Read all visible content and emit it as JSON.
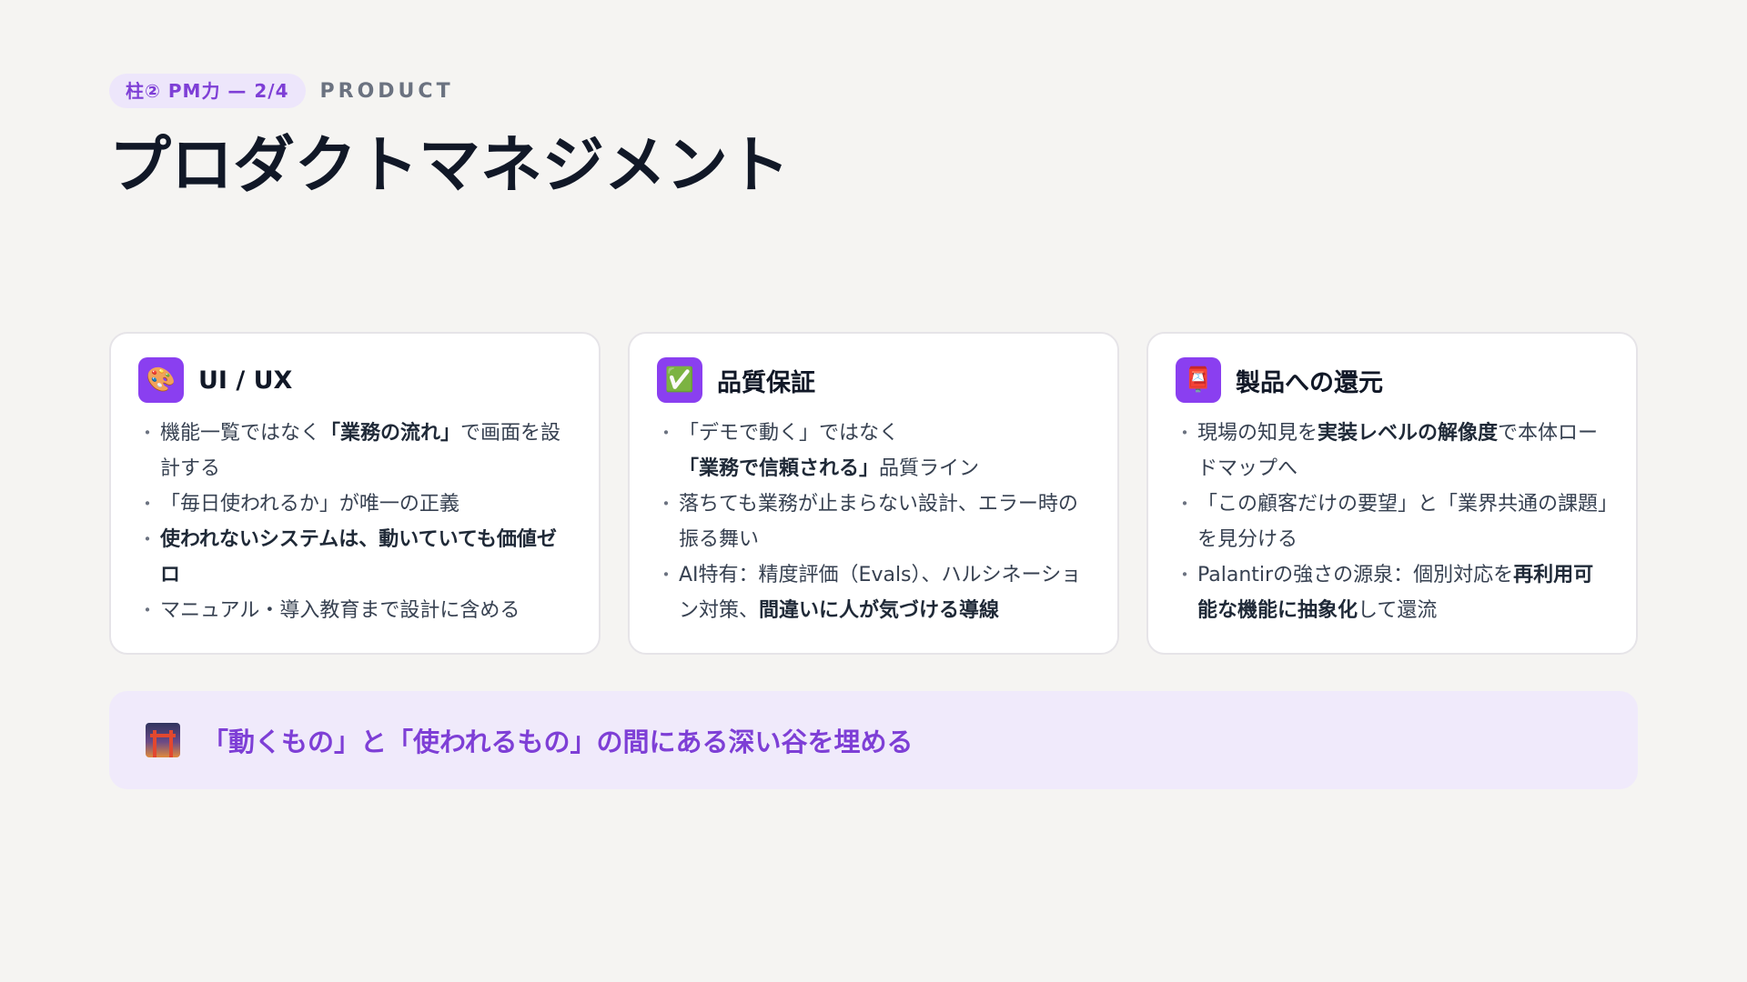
{
  "header": {
    "pill": "柱② PM力 — 2/4",
    "label": "PRODUCT",
    "title": "プロダクトマネジメント"
  },
  "cards": [
    {
      "icon": "palette-icon",
      "title": "UI / UX",
      "bullets": [
        {
          "parts": [
            {
              "t": "機能一覧ではなく"
            },
            {
              "t": "「業務の流れ」",
              "b": true
            },
            {
              "t": "で画面を設計する"
            }
          ]
        },
        {
          "parts": [
            {
              "t": "「毎日使われるか」が唯一の正義"
            }
          ]
        },
        {
          "parts": [
            {
              "t": "使われないシステムは、動いていても価値ゼロ",
              "b": true
            }
          ]
        },
        {
          "parts": [
            {
              "t": "マニュアル・導入教育まで設計に含める"
            }
          ]
        }
      ]
    },
    {
      "icon": "check-mark-icon",
      "title": "品質保証",
      "bullets": [
        {
          "parts": [
            {
              "t": "「デモで動く」ではなく"
            },
            {
              "t": "「業務で信頼される」",
              "b": true
            },
            {
              "t": "品質ライン"
            }
          ]
        },
        {
          "parts": [
            {
              "t": "落ちても業務が止まらない設計、エラー時の振る舞い"
            }
          ]
        },
        {
          "parts": [
            {
              "t": "AI特有：精度評価（Evals）、ハルシネーション対策、"
            },
            {
              "t": "間違いに人が気づける導線",
              "b": true
            }
          ]
        }
      ]
    },
    {
      "icon": "postbox-icon",
      "title": "製品への還元",
      "bullets": [
        {
          "parts": [
            {
              "t": "現場の知見を"
            },
            {
              "t": "実装レベルの解像度",
              "b": true
            },
            {
              "t": "で本体ロードマップへ"
            }
          ]
        },
        {
          "parts": [
            {
              "t": "「この顧客だけの要望」と「業界共通の課題」を見分ける"
            }
          ]
        },
        {
          "parts": [
            {
              "t": "Palantirの強さの源泉：個別対応を"
            },
            {
              "t": "再利用可能な機能に抽象化",
              "b": true
            },
            {
              "t": "して還流"
            }
          ]
        }
      ]
    }
  ],
  "banner": {
    "icon": "bridge-at-night-icon",
    "text": "「動くもの」と「使われるもの」の間にある深い谷を埋める"
  },
  "colors": {
    "accent": "#8a3ff0",
    "accent_text": "#7e3fd6",
    "background": "#f5f4f2",
    "banner_bg": "#f0eafb"
  }
}
